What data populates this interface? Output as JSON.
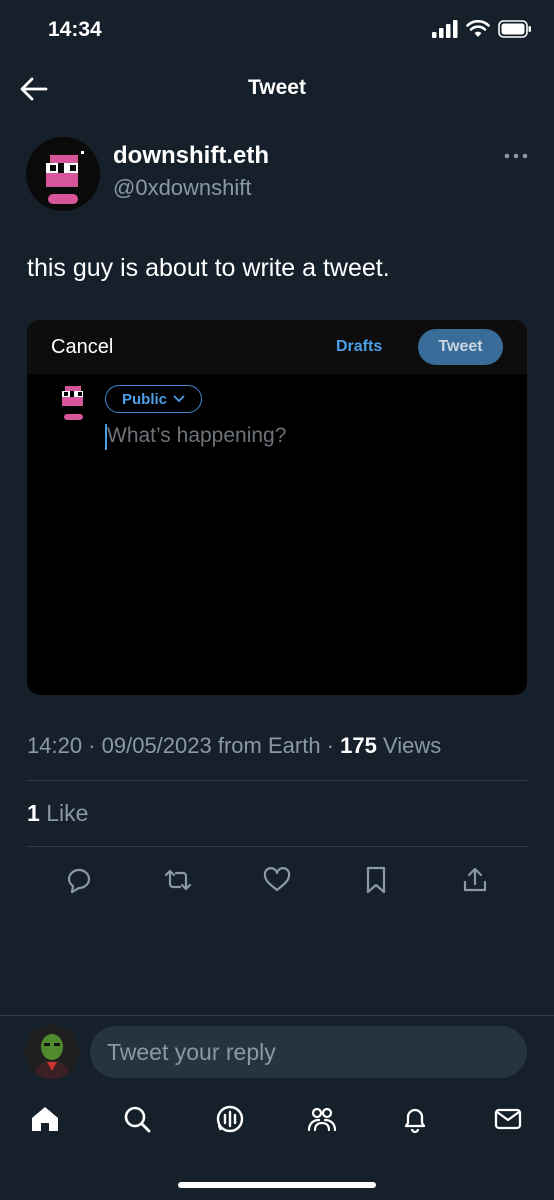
{
  "status": {
    "time": "14:34"
  },
  "header": {
    "title": "Tweet"
  },
  "tweet": {
    "author_name": "downshift.eth",
    "author_handle": "@0xdownshift",
    "text": "this guy is about to write a tweet.",
    "time": "14:20",
    "date": "09/05/2023",
    "source": "from Earth",
    "views_count": "175",
    "views_label": "Views",
    "likes_count": "1",
    "likes_label": "Like"
  },
  "compose": {
    "cancel": "Cancel",
    "drafts": "Drafts",
    "tweet_button": "Tweet",
    "audience": "Public",
    "placeholder": "What’s happening?"
  },
  "reply": {
    "placeholder": "Tweet your reply"
  },
  "icons": {
    "actions": [
      "reply-icon",
      "retweet-icon",
      "like-icon",
      "bookmark-icon",
      "share-icon"
    ],
    "tabs": [
      "home-icon",
      "search-icon",
      "spaces-icon",
      "communities-icon",
      "notifications-icon",
      "messages-icon"
    ]
  },
  "colors": {
    "background": "#15202b",
    "accent": "#4a9fe8",
    "avatar_pink": "#d7559a"
  }
}
